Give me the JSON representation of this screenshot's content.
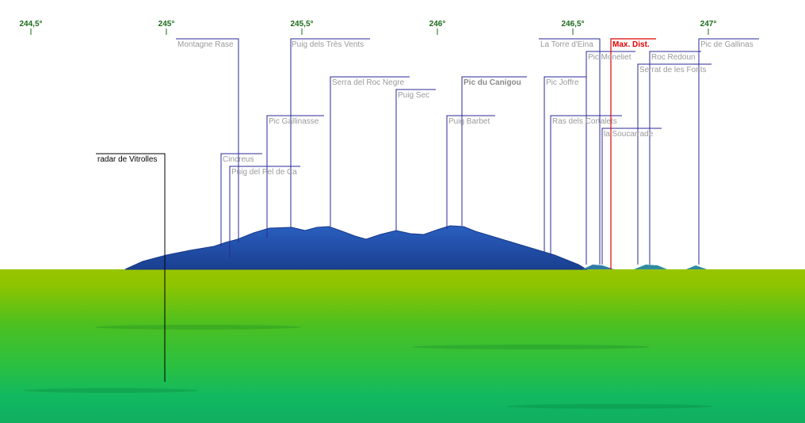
{
  "scale": {
    "ticks": [
      {
        "label": "244,5°"
      },
      {
        "label": "245°"
      },
      {
        "label": "245,5°"
      },
      {
        "label": "246°"
      },
      {
        "label": "246,5°"
      },
      {
        "label": "247°"
      }
    ],
    "tick_color": "#1a6a1a"
  },
  "labels": {
    "montagne_rase": "Montagne Rase",
    "puig_tres_vents": "Puig dels Très Vents",
    "la_torre_deina": "La Torre d'Eina",
    "max_dist": "Max. Dist.",
    "pic_de_gallinas": "Pic de Gallinas",
    "pic_moneliet": "Pic Moneliet",
    "roc_redoun": "Roc Redoun",
    "serrat_de_les_fonts": "Serrat de les Fonts",
    "serra_roc_negre": "Serra del Roc Negre",
    "pic_du_canigou": "Pic du Canigou",
    "pic_joffre": "Pic Joffre",
    "puig_sec": "Puig Sec",
    "pic_gallinasse": "Pic Gallinasse",
    "puig_barbet": "Puig Barbet",
    "ras_dels_cortalets": "Ras dels Cortalets",
    "la_soucarrade": "la Soucarrade",
    "radar_de_vitrolles": "radar de Vitrolles",
    "cincreus": "Cincreus",
    "puig_del_pel_de_ca": "Puig del Pel de Ca"
  },
  "colors": {
    "sky": "#ffffff",
    "mountain": "#1f4faa",
    "leader_line": "#2a2a9a",
    "max_dist": "#e00000",
    "ground_top": "#98c400",
    "ground_bottom": "#0fae60",
    "label_gray": "#9a9a9a"
  }
}
